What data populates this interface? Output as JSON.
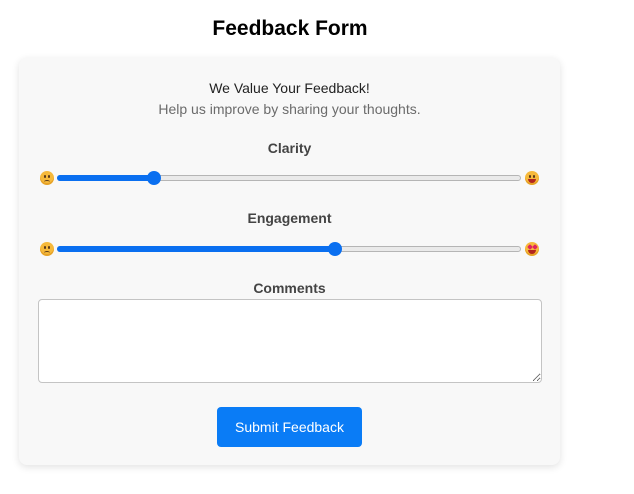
{
  "page": {
    "title": "Feedback Form"
  },
  "form": {
    "intro": "We Value Your Feedback!",
    "subtitle": "Help us improve by sharing your thoughts.",
    "sliders": [
      {
        "label": "Clarity",
        "value_fraction": 0.21,
        "min_icon": "confused-face-icon",
        "max_icon": "grinning-face-icon"
      },
      {
        "label": "Engagement",
        "value_fraction": 0.6,
        "min_icon": "confused-face-icon",
        "max_icon": "heart-eyes-face-icon"
      }
    ],
    "comments": {
      "label": "Comments",
      "value": "",
      "placeholder": ""
    },
    "submit_label": "Submit Feedback"
  },
  "colors": {
    "accent": "#0a6ff0",
    "button": "#0a7cf6",
    "card_background": "#f8f8f8"
  }
}
